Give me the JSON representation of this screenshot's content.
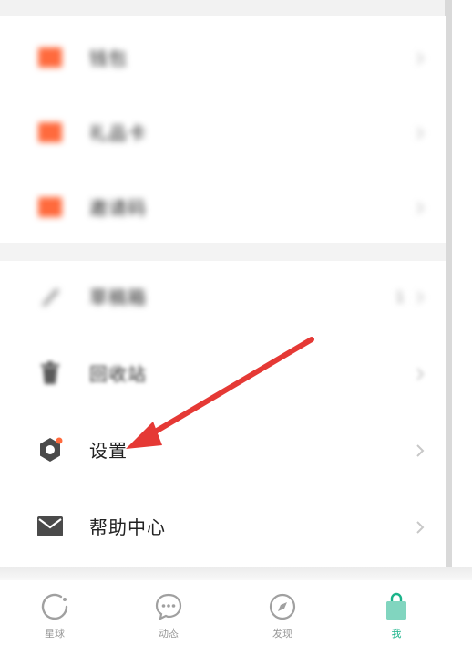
{
  "menu_group_1": {
    "items": [
      {
        "label": "钱包",
        "icon": "wallet-icon",
        "color": "#ff6a3d"
      },
      {
        "label": "礼品卡",
        "icon": "gift-card-icon",
        "color": "#ff6a3d"
      },
      {
        "label": "邀请码",
        "icon": "invite-code-icon",
        "color": "#ff6a3d"
      }
    ]
  },
  "menu_group_2": {
    "items": [
      {
        "label": "草稿箱",
        "icon": "draft-icon",
        "badge": "1"
      },
      {
        "label": "回收站",
        "icon": "trash-icon"
      },
      {
        "label": "设置",
        "icon": "settings-icon",
        "dot_color": "#ff6a3d"
      },
      {
        "label": "帮助中心",
        "icon": "mail-icon"
      }
    ]
  },
  "tabbar": {
    "tabs": [
      {
        "label": "星球",
        "icon": "planet-icon"
      },
      {
        "label": "动态",
        "icon": "chat-bubble-icon"
      },
      {
        "label": "发现",
        "icon": "compass-icon"
      },
      {
        "label": "我",
        "icon": "bag-icon",
        "active": true
      }
    ],
    "active_color": "#1bb38a",
    "inactive_color": "#9a9a9a"
  },
  "annotation": {
    "arrow_color": "#e53935"
  }
}
